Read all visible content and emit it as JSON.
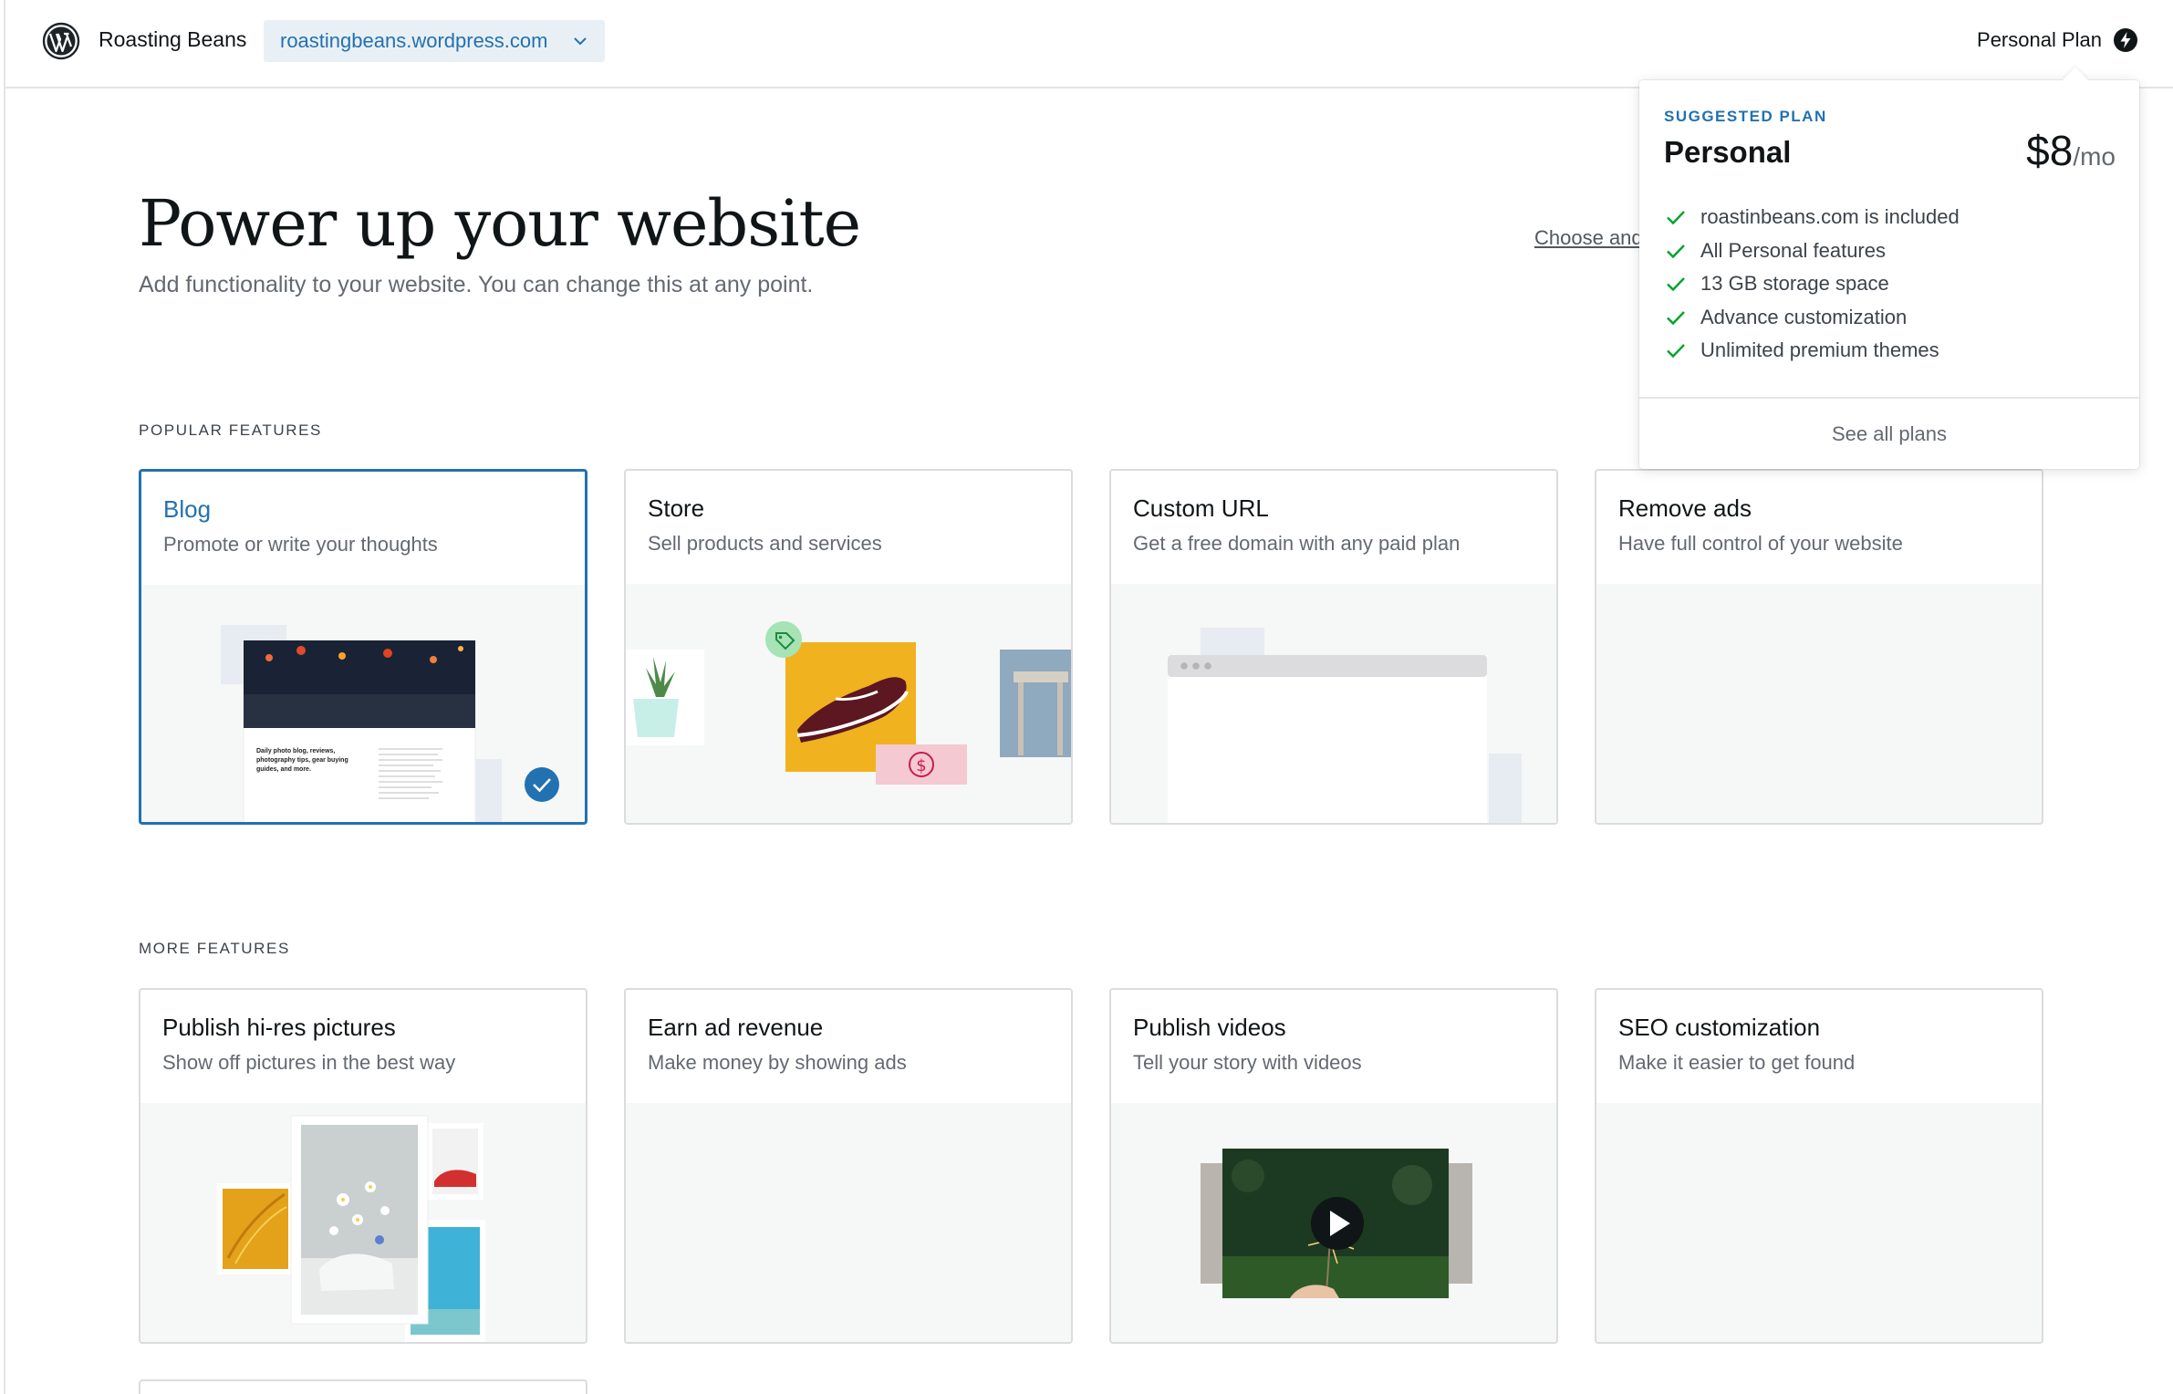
{
  "topbar": {
    "site_name": "Roasting Beans",
    "site_url": "roastingbeans.wordpress.com",
    "plan_label": "Personal Plan"
  },
  "header": {
    "title": "Power up your website",
    "subtitle": "Add functionality to your website. You can change this at any point.",
    "choose_link": "Choose and"
  },
  "popular": {
    "label": "POPULAR FEATURES",
    "cards": [
      {
        "title": "Blog",
        "desc": "Promote or write your thoughts",
        "selected": true,
        "preview_text": [
          "Daily photo blog, reviews,",
          "photography tips, gear buying",
          "guides, and more."
        ]
      },
      {
        "title": "Store",
        "desc": "Sell products and services",
        "currency_symbol": "$"
      },
      {
        "title": "Custom URL",
        "desc": "Get a free domain with any paid plan"
      },
      {
        "title": "Remove ads",
        "desc": "Have full control of your website"
      }
    ]
  },
  "more": {
    "label": "MORE FEATURES",
    "cards": [
      {
        "title": "Publish hi-res pictures",
        "desc": "Show off pictures in the best way"
      },
      {
        "title": "Earn ad revenue",
        "desc": "Make money by showing ads"
      },
      {
        "title": "Publish videos",
        "desc": "Tell your story with videos"
      },
      {
        "title": "SEO customization",
        "desc": "Make it easier to get found"
      }
    ]
  },
  "popover": {
    "label": "SUGGESTED PLAN",
    "plan_name": "Personal",
    "price": "$8",
    "per": "/mo",
    "features": [
      "roastinbeans.com is included",
      "All Personal features",
      "13 GB storage space",
      "Advance customization",
      "Unlimited premium themes"
    ],
    "footer_link": "See all plans"
  },
  "colors": {
    "accent": "#2271b1",
    "check": "#00a32a",
    "border": "#dcdcde",
    "card_bg": "#f6f7f7"
  },
  "icons": [
    "wordpress-logo-icon",
    "chevron-down-icon",
    "bolt-icon",
    "checkmark-icon",
    "tag-icon",
    "dollar-icon",
    "play-icon"
  ]
}
